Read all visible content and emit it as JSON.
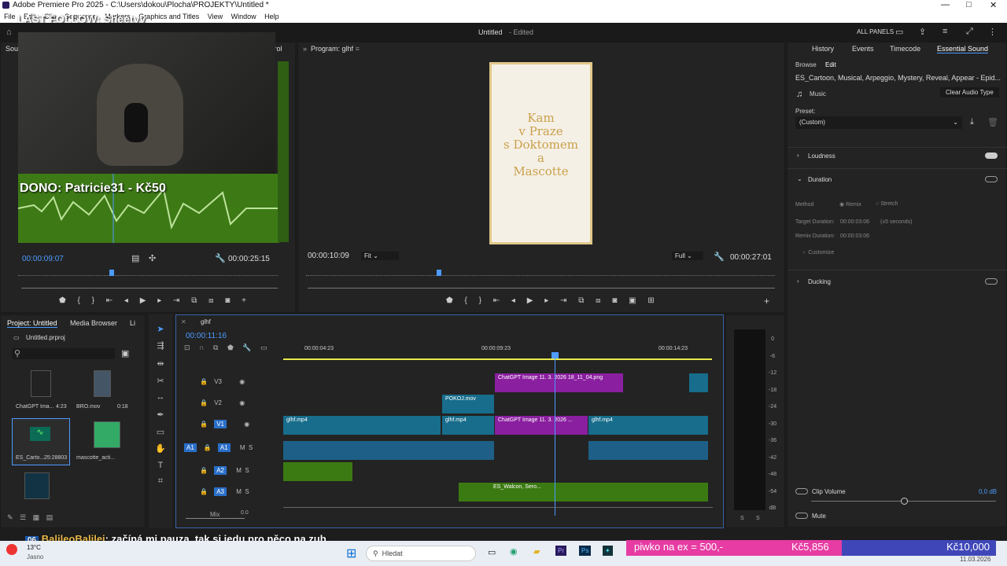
{
  "window": {
    "title": "Adobe Premiere Pro 2025 - C:\\Users\\dokou\\Plocha\\PROJEKTY\\Untitled *",
    "controls": [
      "—",
      "□",
      "✕"
    ]
  },
  "menu": [
    "File",
    "Edit",
    "Clip",
    "Sequence",
    "Markers",
    "Graphics and Titles",
    "View",
    "Window",
    "Help"
  ],
  "workspace": {
    "title": "Untitled",
    "edited": "- Edited",
    "all_panels": "ALL PANELS"
  },
  "overlay": {
    "username": "LAST FOLLOW: Sheetyy",
    "donation": "DONO: Patricie31 - Kč50",
    "chat_user": "BalileoBalilei",
    "chat_msg": ": začíná mi pauza, tak si jedu pro něco na zub",
    "badge": "06"
  },
  "source": {
    "tab": "Sour",
    "tab2": "ntrol",
    "tc_left": "00:00:09:07",
    "tc_right": "00:00:25:15"
  },
  "program": {
    "label": "Program: glhf",
    "tc_left": "00:00:10:09",
    "fit": "Fit",
    "full": "Full",
    "tc_right": "00:00:27:01",
    "poster_lines": [
      "Kam",
      "v Praze",
      "s Doktomem",
      "a",
      "Mascotte"
    ]
  },
  "tabs_right": [
    "History",
    "Events",
    "Timecode",
    "Essential Sound"
  ],
  "essential": {
    "browse": "Browse",
    "edit": "Edit",
    "clip": "ES_Cartoon, Musical, Arpeggio, Mystery, Reveal, Appear - Epid...",
    "music": "Music",
    "clear": "Clear Audio Type",
    "preset": "Preset:",
    "preset_val": "(Custom)",
    "loudness": "Loudness",
    "duration": "Duration",
    "method": "Method",
    "remix": "Remix",
    "stretch": "Stretch",
    "target": "Target Duration:",
    "target_val": "00:00:03:06",
    "target_sec": "(±5 seconds)",
    "remix_dur": "Remix Duration:",
    "remix_val": "00:00:03:06",
    "customize": "Customize",
    "ducking": "Ducking",
    "clip_volume": "Clip Volume",
    "clip_volume_val": "0,0 dB",
    "mute": "Mute"
  },
  "project": {
    "tab": "Project: Untitled",
    "tab2": "Media Browser",
    "tab3": "Li",
    "file": "Untitled.prproj",
    "items": [
      {
        "name": "ChatGPT Ima...",
        "dur": "4:23"
      },
      {
        "name": "BRO.mov",
        "dur": "0:18"
      },
      {
        "name": "ES_Carto...",
        "dur": "25:28803"
      },
      {
        "name": "mascotte_acti...",
        "dur": ""
      }
    ]
  },
  "timeline": {
    "seq": "glhf",
    "tc": "00:00:11:16",
    "ruler": [
      "00:00:04:23",
      "00:00:09:23",
      "00:00:14:23"
    ],
    "tracks": [
      "V3",
      "V2",
      "V1",
      "A1",
      "A2",
      "A3"
    ],
    "mix": "Mix",
    "mix_val": "0.0",
    "clips": {
      "v3a": "ChatGPT Image 11. 3. 2026 18_11_04.png",
      "v2a": "POKOJ.mov",
      "v1a": "glhf.mp4",
      "v1b": "glhf.mp4",
      "v1c": "ChatGPT Image 11. 3. 2026 ...",
      "v1d": "glhf.mp4",
      "a3": "ES_Walcon, Sero..."
    }
  },
  "meter": [
    "0",
    "-6",
    "-12",
    "-18",
    "-24",
    "-30",
    "-36",
    "-42",
    "-48",
    "-54",
    "dB"
  ],
  "meter_foot": [
    "S",
    "S"
  ],
  "donation_bar": {
    "left": "piwko na ex = 500,-",
    "mid": "Kč5,856",
    "right": "Kč10,000"
  },
  "taskbar": {
    "temp": "13°C",
    "weather": "Jasno",
    "search": "Hledat",
    "date": "11.03.2026"
  }
}
